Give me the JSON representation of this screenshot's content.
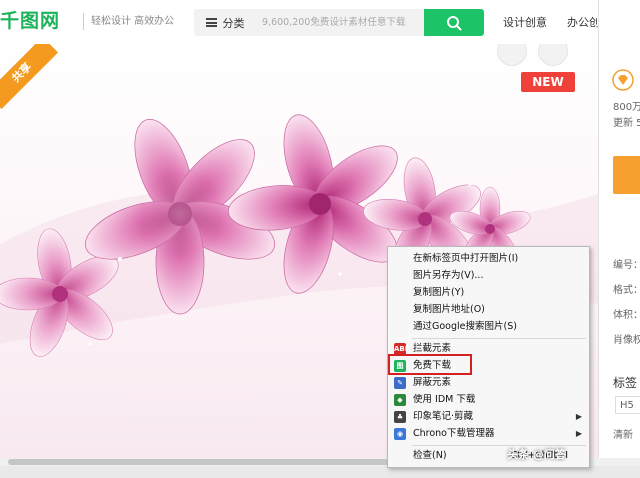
{
  "header": {
    "logo": "千图网",
    "slogan": "轻松设计 高效办公",
    "category_label": "分类",
    "search_placeholder": "9,600,200免费设计素材任意下载",
    "nav": [
      "设计创意",
      "办公创意"
    ]
  },
  "image": {
    "share_ribbon": "共享",
    "new_badge": "NEW"
  },
  "sidebar": {
    "lines": [
      "800万",
      "更新 5"
    ],
    "fields": [
      "编号：",
      "格式：",
      "体积：",
      "肖像权"
    ],
    "tags_title": "标签",
    "tag_box": "H5",
    "tag_link": "清新"
  },
  "context_menu": {
    "items": [
      {
        "label": "在新标签页中打开图片(I)"
      },
      {
        "label": "图片另存为(V)..."
      },
      {
        "label": "复制图片(Y)"
      },
      {
        "label": "复制图片地址(O)"
      },
      {
        "label": "通过Google搜索图片(S)"
      },
      {
        "label": "拦截元素",
        "icon": "abp-icon",
        "icon_text": "ABP",
        "icon_color": "#d42a2a"
      },
      {
        "label": "免费下载",
        "icon": "download-tool-icon",
        "icon_text": "图",
        "icon_color": "#1cb35b"
      },
      {
        "label": "屏蔽元素",
        "icon": "feather-icon",
        "icon_text": "✎",
        "icon_color": "#3b6cc7"
      },
      {
        "label": "使用 IDM 下载",
        "icon": "idm-icon",
        "icon_text": "◆",
        "icon_color": "#2a8a3a"
      },
      {
        "label": "印象笔记·剪藏",
        "icon": "evernote-icon",
        "icon_text": "♣",
        "icon_color": "#444444",
        "submenu": true
      },
      {
        "label": "Chrono下载管理器",
        "icon": "chrono-icon",
        "icon_text": "◉",
        "icon_color": "#3a78d8",
        "submenu": true
      },
      {
        "label": "检查(N)",
        "shortcut": "Ctrl+Shift+I"
      }
    ]
  },
  "watermark": "头条 @问答",
  "colors": {
    "brand_green": "#1cb35b",
    "search_green": "#1ec267",
    "new_red": "#f0403a",
    "ribbon_orange": "#f39a1f",
    "highlight_red": "#d42020"
  }
}
